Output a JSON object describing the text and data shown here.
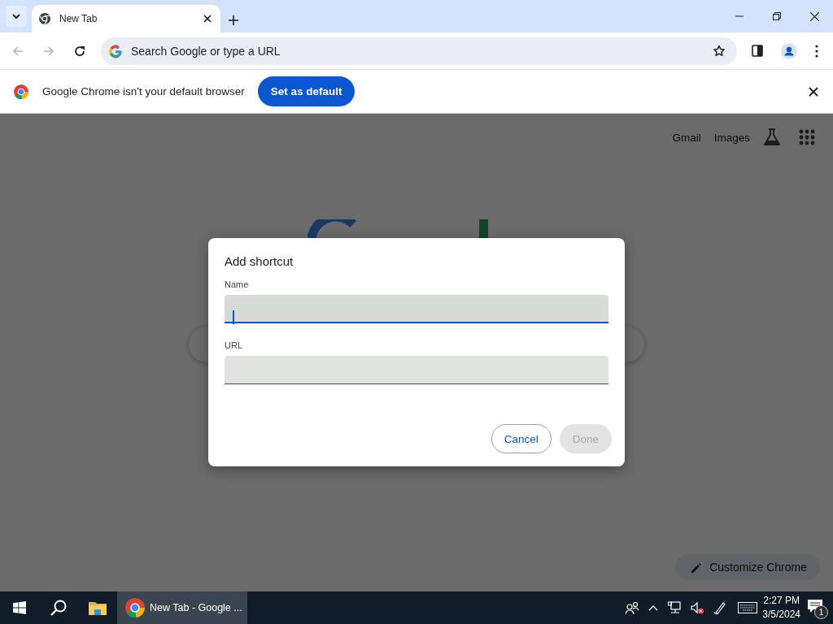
{
  "browser": {
    "tabs": [
      {
        "title": "New Tab",
        "selected": true
      }
    ],
    "omnibox": {
      "placeholder": "Search Google or type a URL"
    },
    "infobar": {
      "message": "Google Chrome isn't your default browser",
      "button": "Set as default"
    }
  },
  "page": {
    "links": [
      "Gmail",
      "Images"
    ],
    "customize_button": "Customize Chrome"
  },
  "dialog": {
    "title": "Add shortcut",
    "fields": [
      {
        "label": "Name",
        "focused": true
      },
      {
        "label": "URL",
        "focused": false
      }
    ],
    "buttons": [
      {
        "label": "Cancel",
        "disabled": false
      },
      {
        "label": "Done",
        "disabled": true
      }
    ]
  },
  "taskbar": {
    "apps": [
      {
        "label": "New Tab - Google ...",
        "selected": true
      }
    ],
    "time": "2:27 PM",
    "date": "3/5/2024",
    "notifications": "1"
  }
}
